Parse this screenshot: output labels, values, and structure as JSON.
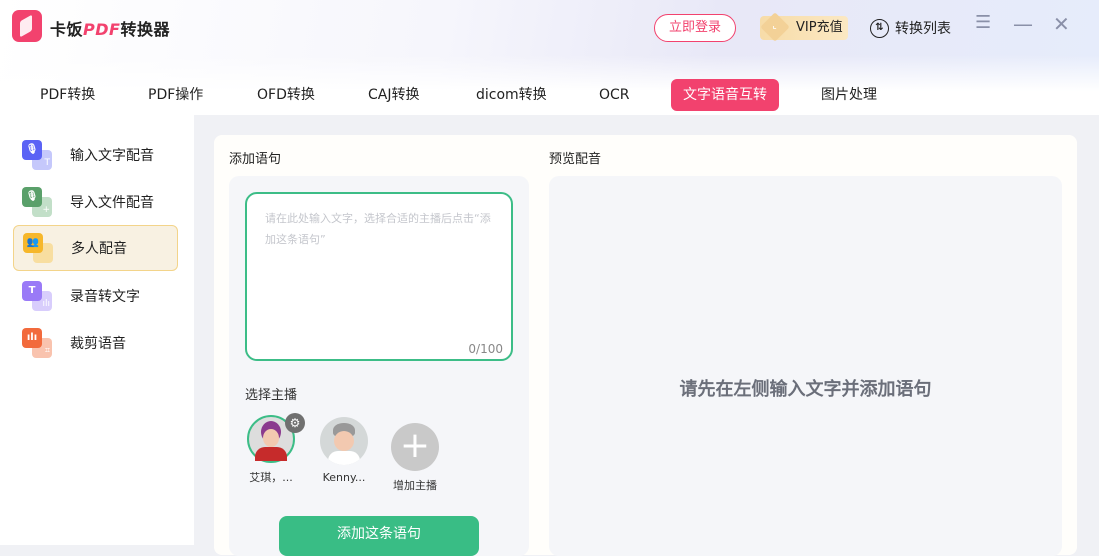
{
  "app": {
    "brand_prefix": "卡饭",
    "brand_pdf": "PDF",
    "brand_suffix": "转换器",
    "login": "立即登录",
    "vip": "VIP充值",
    "conversion_list": "转换列表"
  },
  "tabs": [
    "PDF转换",
    "PDF操作",
    "OFD转换",
    "CAJ转换",
    "dicom转换",
    "OCR",
    "文字语音互转",
    "图片处理"
  ],
  "active_tab": "文字语音互转",
  "sidebar": [
    {
      "label": "输入文字配音",
      "color": "#5b63f5",
      "color2": "#c5c8fb"
    },
    {
      "label": "导入文件配音",
      "color": "#5aa06a",
      "color2": "#c2dfc8"
    },
    {
      "label": "多人配音",
      "color": "#f6b72a",
      "color2": "#f8dea0"
    },
    {
      "label": "录音转文字",
      "color": "#9a7af7",
      "color2": "#d8cdfc"
    },
    {
      "label": "裁剪语音",
      "color": "#f26a3c",
      "color2": "#f9c3ae"
    }
  ],
  "main": {
    "add_title": "添加语句",
    "preview_title": "预览配音",
    "placeholder": "请在此处输入文字，选择合适的主播后点击“添加这条语句”",
    "count": "0/100",
    "select_anchor": "选择主播",
    "anchors": [
      "艾琪，...",
      "Kenny..."
    ],
    "add_anchor": "增加主播",
    "add_button": "添加这条语句",
    "empty_text": "请先在左侧输入文字并添加语句"
  },
  "colors": {
    "accent": "#f2426e",
    "green": "#39bd85"
  }
}
